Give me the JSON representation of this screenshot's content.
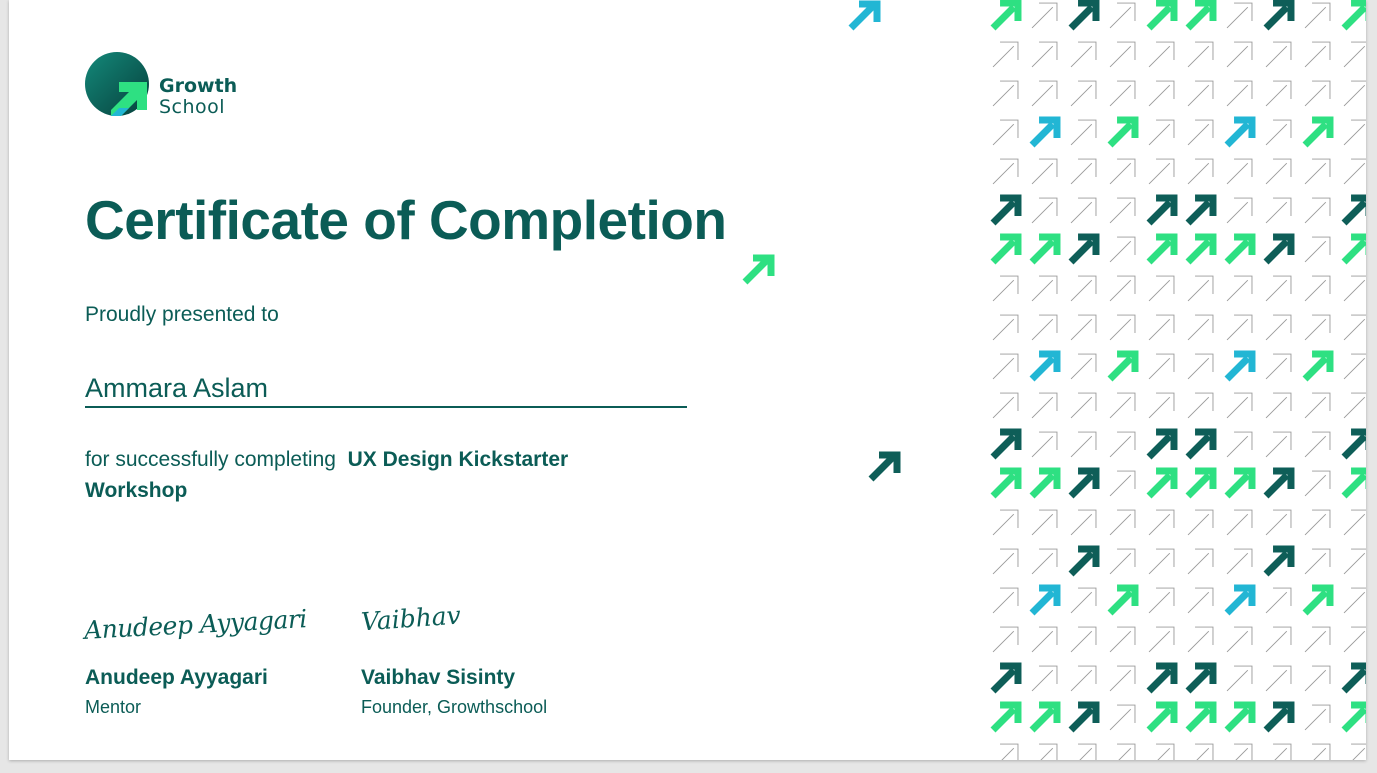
{
  "brand": {
    "name_line1": "Growth",
    "name_line2": "School",
    "colors": {
      "dark": "#0b5c56",
      "green": "#2ee082",
      "blue": "#22b6d4",
      "teal": "#0e5e58"
    },
    "logo_icon": "arrow-up-right-icon"
  },
  "certificate": {
    "title": "Certificate of Completion",
    "presented_label": "Proudly presented to",
    "recipient": "Ammara Aslam",
    "completion_prefix": "for successfully completing",
    "course": "UX Design Kickstarter Workshop"
  },
  "signatories": [
    {
      "signature": "Anudeep Ayyagari",
      "name": "Anudeep Ayyagari",
      "role": "Mentor"
    },
    {
      "signature": "Vaibhav",
      "name": "Vaibhav Sisinty",
      "role": "Founder, Growthschool"
    }
  ],
  "decoration": {
    "icon": "arrow-up-right-icon",
    "pattern": "diagonal-arrow-pattern"
  }
}
